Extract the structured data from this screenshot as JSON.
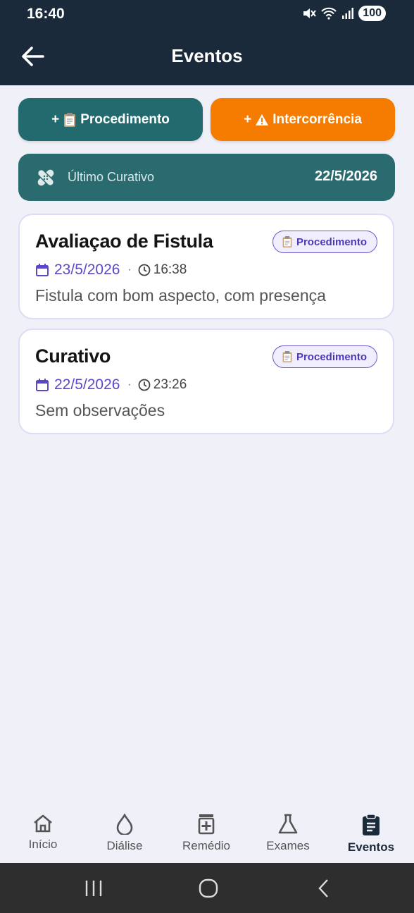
{
  "status_bar": {
    "time": "16:40",
    "battery": "100"
  },
  "header": {
    "title": "Eventos"
  },
  "actions": {
    "procedimento_label": "Procedimento",
    "intercorrencia_label": "Intercorrência",
    "plus": "+"
  },
  "last_dressing": {
    "label": "Último Curativo",
    "date": "22/5/2026"
  },
  "events": [
    {
      "title": "Avaliaçao de Fistula",
      "badge": "Procedimento",
      "date": "23/5/2026",
      "time": "16:38",
      "description": "Fistula com bom aspecto, com presença"
    },
    {
      "title": "Curativo",
      "badge": "Procedimento",
      "date": "22/5/2026",
      "time": "23:26",
      "description": "Sem observações"
    }
  ],
  "nav": {
    "items": [
      {
        "label": "Início",
        "icon": "home-icon"
      },
      {
        "label": "Diálise",
        "icon": "drop-icon"
      },
      {
        "label": "Remédio",
        "icon": "medicine-icon"
      },
      {
        "label": "Exames",
        "icon": "flask-icon"
      },
      {
        "label": "Eventos",
        "icon": "clipboard-icon",
        "active": true
      }
    ]
  },
  "colors": {
    "header_bg": "#1b2a3a",
    "teal": "#236a6f",
    "orange": "#f57c00",
    "accent_purple": "#5a48c8"
  }
}
